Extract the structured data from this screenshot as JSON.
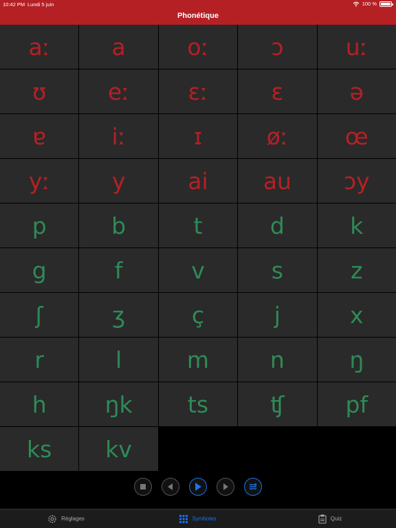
{
  "status_bar": {
    "time": "10:42 PM",
    "date": "Lundi 5 juin",
    "battery": "100 %"
  },
  "header": {
    "title": "Phonétique"
  },
  "colors": {
    "header": "#b52025",
    "vowel": "#b52025",
    "consonant": "#2e8b57",
    "accent": "#1a73e8"
  },
  "vowels": [
    "aː",
    "a",
    "oː",
    "ɔ",
    "uː",
    "ʊ",
    "eː",
    "ɛː",
    "ɛ",
    "ə",
    "ɐ",
    "iː",
    "ɪ",
    "øː",
    "œ",
    "yː",
    "y",
    "ai",
    "au",
    "ɔy"
  ],
  "consonants": [
    "p",
    "b",
    "t",
    "d",
    "k",
    "g",
    "f",
    "v",
    "s",
    "z",
    "ʃ",
    "ʒ",
    "ç",
    "j",
    "x",
    "r",
    "l",
    "m",
    "n",
    "ŋ",
    "h",
    "ŋk",
    "ts",
    "ʧ",
    "pf",
    "ks",
    "kv"
  ],
  "player": {
    "buttons": [
      "stop-icon",
      "previous-icon",
      "play-icon",
      "next-icon",
      "list-icon"
    ]
  },
  "tabbar": {
    "tabs": [
      {
        "label": "Réglages",
        "icon": "gear-icon"
      },
      {
        "label": "Symboles",
        "icon": "grid-icon"
      },
      {
        "label": "Quiz",
        "icon": "clipboard-icon"
      }
    ]
  }
}
